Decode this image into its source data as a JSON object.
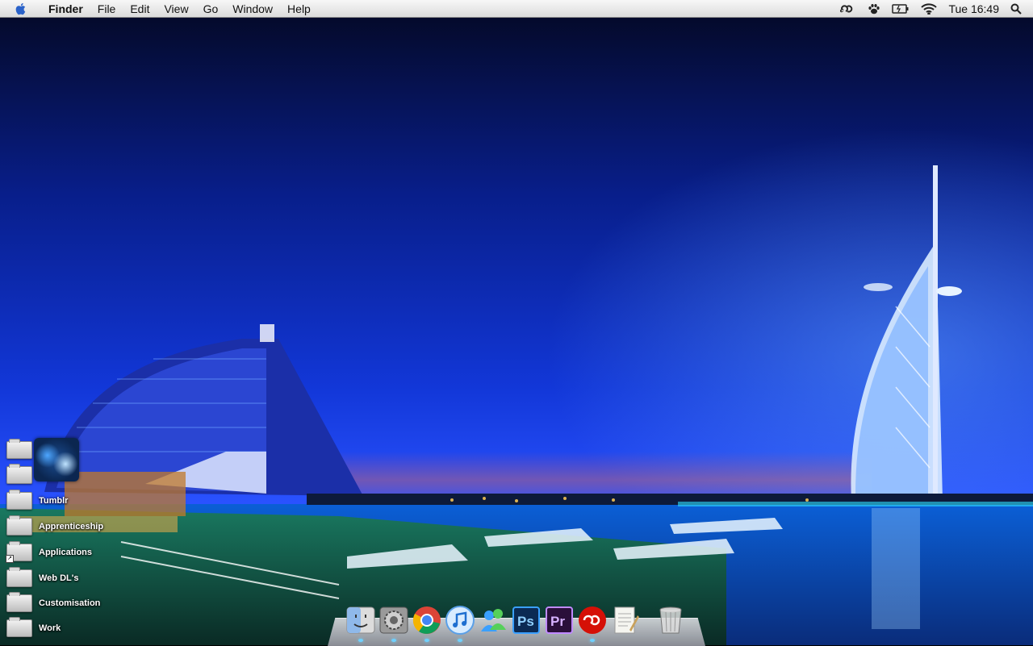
{
  "menubar": {
    "apple_icon": "apple-icon",
    "app_name": "Finder",
    "items": [
      "File",
      "Edit",
      "View",
      "Go",
      "Window",
      "Help"
    ],
    "status_icons": [
      "lastfm-icon",
      "growl-paw-icon",
      "battery-icon",
      "wifi-icon"
    ],
    "clock": "Tue 16:49",
    "spotlight_icon": "search-icon"
  },
  "desktop": {
    "items": [
      {
        "label": "",
        "kind": "folder"
      },
      {
        "label": "",
        "kind": "folder"
      },
      {
        "label": "Tumblr",
        "kind": "folder"
      },
      {
        "label": "Apprenticeship",
        "kind": "folder"
      },
      {
        "label": "Applications",
        "kind": "alias-folder"
      },
      {
        "label": "Web DL's",
        "kind": "folder"
      },
      {
        "label": "Customisation",
        "kind": "folder"
      },
      {
        "label": "Work",
        "kind": "folder"
      }
    ]
  },
  "dock": {
    "apps": [
      {
        "name": "finder-icon",
        "label": "Finder"
      },
      {
        "name": "system-preferences-icon",
        "label": "System Preferences"
      },
      {
        "name": "chrome-icon",
        "label": "Google Chrome"
      },
      {
        "name": "itunes-icon",
        "label": "iTunes"
      },
      {
        "name": "messenger-icon",
        "label": "Messenger"
      },
      {
        "name": "photoshop-icon",
        "label": "Ps"
      },
      {
        "name": "premiere-icon",
        "label": "Pr"
      },
      {
        "name": "lastfm-icon",
        "label": "Last.fm"
      },
      {
        "name": "textedit-icon",
        "label": "TextEdit"
      }
    ],
    "trash": {
      "name": "trash-icon",
      "label": "Trash"
    }
  },
  "colors": {
    "sky_top": "#050a3a",
    "sky_mid": "#0b2fc4",
    "sky_horizon": "#3557ff",
    "water": "#0a6bd8",
    "accent_green": "#2fe07a"
  }
}
